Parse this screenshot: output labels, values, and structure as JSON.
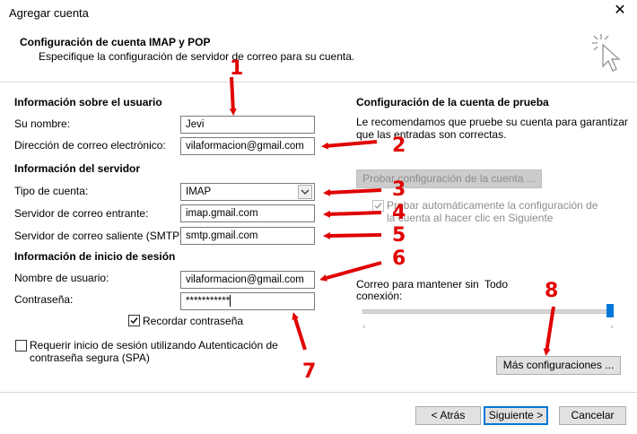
{
  "window": {
    "title": "Agregar cuenta",
    "close_glyph": "✕"
  },
  "header": {
    "title": "Configuración de cuenta IMAP y POP",
    "subtitle": "Especifique la configuración de servidor de correo para su cuenta."
  },
  "user_info": {
    "heading": "Información sobre el usuario",
    "name_label": "Su nombre:",
    "name_value": "Jevi",
    "email_label": "Dirección de correo electrónico:",
    "email_value": "vilaformacion@gmail.com"
  },
  "server_info": {
    "heading": "Información del servidor",
    "account_type_label": "Tipo de cuenta:",
    "account_type_value": "IMAP",
    "incoming_label": "Servidor de correo entrante:",
    "incoming_value": "imap.gmail.com",
    "outgoing_label": "Servidor de correo saliente (SMTP):",
    "outgoing_value": "smtp.gmail.com"
  },
  "login_info": {
    "heading": "Información de inicio de sesión",
    "username_label": "Nombre de usuario:",
    "username_value": "vilaformacion@gmail.com",
    "password_label": "Contraseña:",
    "password_value": "***********",
    "remember_label": "Recordar contraseña",
    "remember_checked": true,
    "spa_label_line1": "Requerir inicio de sesión utilizando Autenticación de",
    "spa_label_line2": "contraseña segura (SPA)",
    "spa_checked": false
  },
  "test_settings": {
    "heading": "Configuración de la cuenta de prueba",
    "desc_line1": "Le recomendamos que pruebe su cuenta para garantizar",
    "desc_line2": "que las entradas son correctas.",
    "test_button": "Probar configuración de la cuenta ...",
    "auto_test_line1": "Probar automáticamente la configuración de",
    "auto_test_line2": "la cuenta al hacer clic en Siguiente",
    "offline_label_line1": "Correo para mantener sin",
    "offline_label_line2": "conexión:",
    "offline_value": "Todo",
    "slider_level": 1.0,
    "more_settings_button": "Más configuraciones ..."
  },
  "footer": {
    "back_button": "< Atrás",
    "next_button": "Siguiente >",
    "cancel_button": "Cancelar"
  },
  "annotations": {
    "n1": "1",
    "n2": "2",
    "n3": "3",
    "n4": "4",
    "n5": "5",
    "n6": "6",
    "n7": "7",
    "n8": "8"
  },
  "colors": {
    "annotation": "#e00000",
    "slider_thumb": "#0078d7",
    "primary_border": "#0078d7"
  },
  "icons": {
    "header_icon": "cursor-click-icon",
    "dropdown": "chevron-down-icon"
  }
}
